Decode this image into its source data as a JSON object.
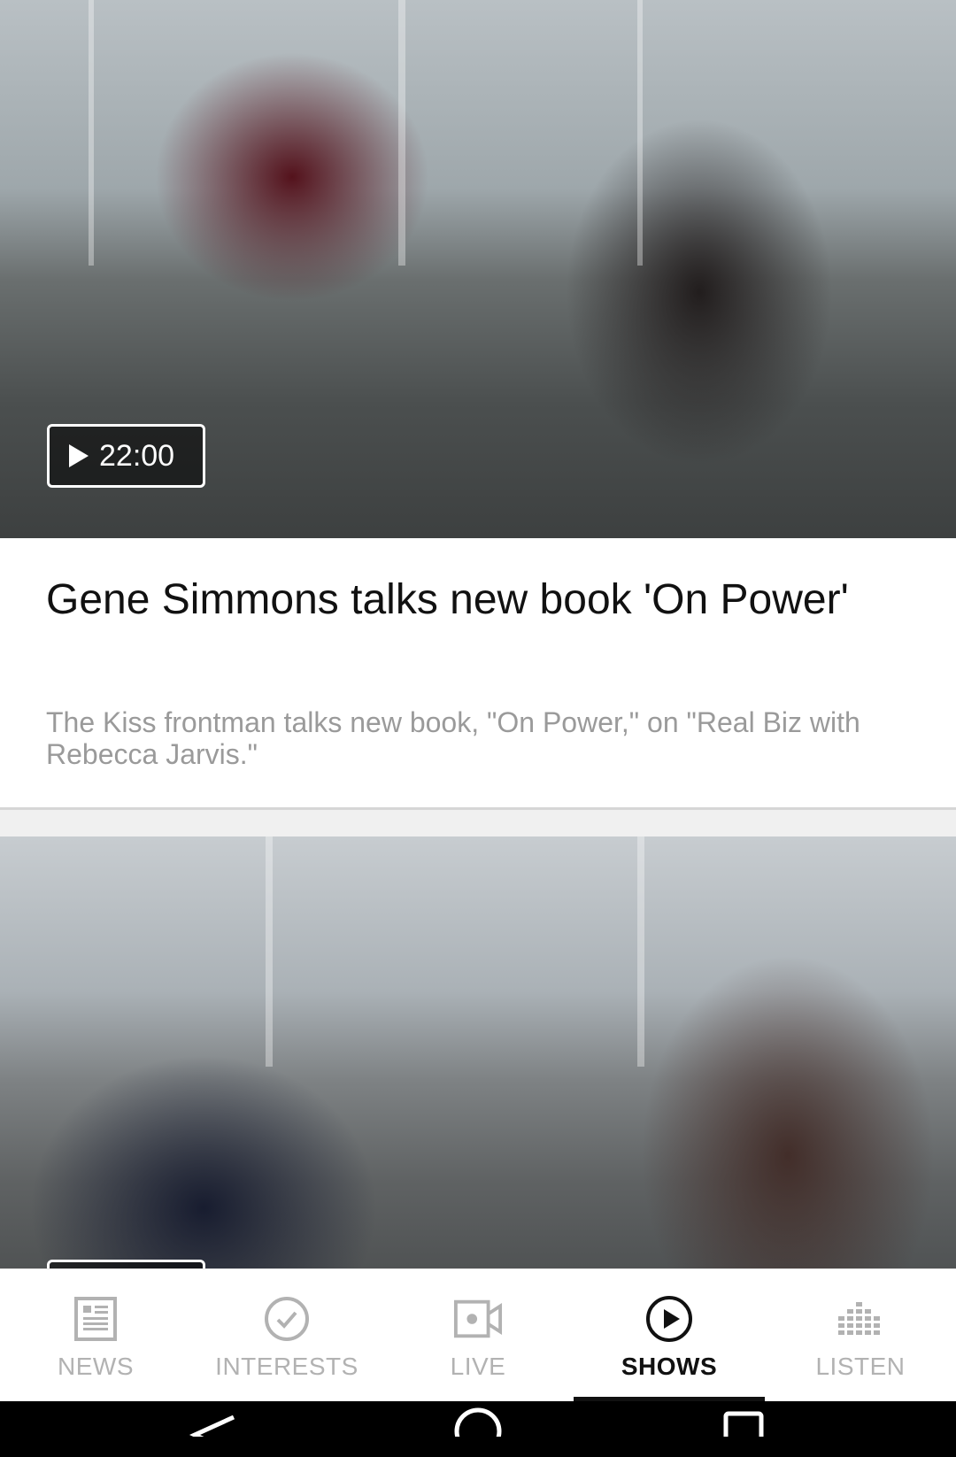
{
  "cards": [
    {
      "duration": "22:00",
      "title": "Gene Simmons talks new book 'On Power'",
      "description": "The Kiss frontman talks new book, \"On Power,\" on \"Real Biz with Rebecca Jarvis.\""
    }
  ],
  "nav": {
    "items": [
      {
        "label": "NEWS",
        "icon": "news-icon"
      },
      {
        "label": "INTERESTS",
        "icon": "check-circle-icon"
      },
      {
        "label": "LIVE",
        "icon": "video-camera-icon"
      },
      {
        "label": "SHOWS",
        "icon": "play-circle-icon"
      },
      {
        "label": "LISTEN",
        "icon": "equalizer-icon"
      }
    ],
    "active": "SHOWS"
  },
  "colors": {
    "active": "#111111",
    "inactive": "#b2b2b2",
    "description": "#9a9a9a"
  }
}
